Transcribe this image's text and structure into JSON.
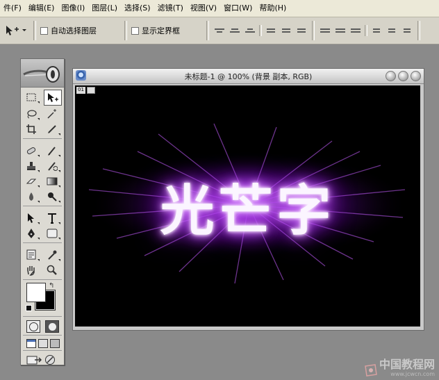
{
  "menu": {
    "items": [
      "件(F)",
      "编辑(E)",
      "图像(I)",
      "图层(L)",
      "选择(S)",
      "滤镜(T)",
      "视图(V)",
      "窗口(W)",
      "帮助(H)"
    ]
  },
  "options": {
    "auto_select_label": "自动选择图层",
    "show_bounds_label": "显示定界框"
  },
  "document": {
    "title": "未标题-1 @ 100% (背景 副本, RGB)",
    "layer_badge": "01",
    "canvas_text": "光芒字",
    "glow_color": "#a52ce8"
  },
  "toolbox": {
    "foreground_color": "#ffffff",
    "background_color": "#000000"
  },
  "watermark": {
    "brand": "中国教程网",
    "url": "www.jcwcn.com"
  }
}
